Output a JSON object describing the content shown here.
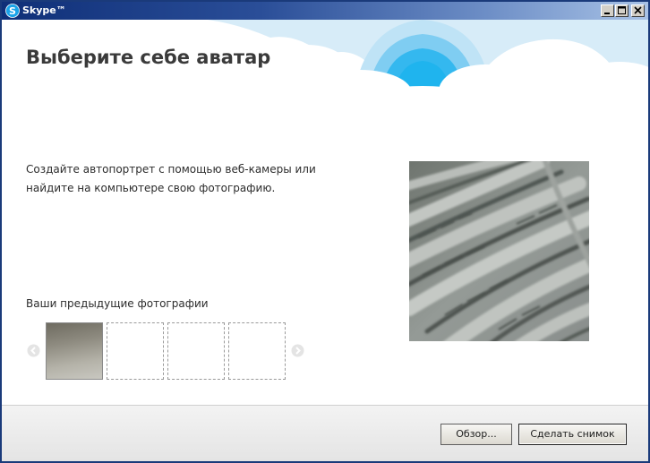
{
  "window": {
    "title": "Skype™",
    "accent_color": "#0f2f78"
  },
  "titlebar_buttons": {
    "minimize_icon": "minimize-icon",
    "maximize_icon": "maximize-icon",
    "close_icon": "close-icon"
  },
  "main": {
    "heading": "Выберите себе аватар",
    "description_line1": "Создайте автопортрет с помощью веб-камеры или",
    "description_line2": "найдите на компьютере свою фотографию.",
    "previous_photos_label": "Ваши предыдущие фотографии",
    "thumbnails": [
      {
        "filled": true
      },
      {
        "filled": false
      },
      {
        "filled": false
      },
      {
        "filled": false
      }
    ],
    "nav_icons": [
      "chevron-left-icon",
      "chevron-right-icon"
    ]
  },
  "footer": {
    "browse_label": "Обзор...",
    "snapshot_label": "Сделать снимок"
  },
  "colors": {
    "sky_light": "#d8eef8",
    "sky_arc": "#1fb4ee",
    "footer_bg": "#e8e8e8"
  }
}
